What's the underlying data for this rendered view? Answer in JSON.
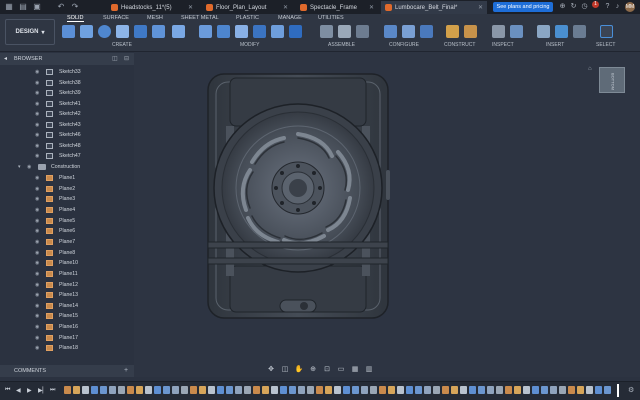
{
  "tabs": [
    {
      "label": "Headstocks_11*(5)",
      "active": false
    },
    {
      "label": "Floor_Plan_Layout",
      "active": false
    },
    {
      "label": "Spectacle_Frame",
      "active": false
    },
    {
      "label": "Lumbocare_Belt_Final*",
      "active": true
    }
  ],
  "top_right": {
    "plans_button": "See plans and pricing",
    "notification_count": "1"
  },
  "ribbon": {
    "workspace_button": "DESIGN",
    "workspace_tabs": [
      "SOLID",
      "SURFACE",
      "MESH",
      "SHEET METAL",
      "PLASTIC",
      "MANAGE",
      "UTILITIES"
    ],
    "groups": [
      "CREATE",
      "MODIFY",
      "ASSEMBLE",
      "CONFIGURE",
      "CONSTRUCT",
      "INSPECT",
      "INSERT",
      "SELECT"
    ]
  },
  "browser": {
    "title": "BROWSER",
    "sketches": [
      "Sketch33",
      "Sketch38",
      "Sketch39",
      "Sketch41",
      "Sketch42",
      "Sketch43",
      "Sketch46",
      "Sketch48",
      "Sketch47"
    ],
    "folder": "Construction",
    "planes": [
      "Plane1",
      "Plane2",
      "Plane3",
      "Plane4",
      "Plane5",
      "Plane6",
      "Plane7",
      "Plane8",
      "Plane10",
      "Plane11",
      "Plane12",
      "Plane13",
      "Plane14",
      "Plane15",
      "Plane16",
      "Plane17",
      "Plane18"
    ]
  },
  "comments": {
    "title": "COMMENTS"
  },
  "viewcube": {
    "face_label": "BOTTOM"
  },
  "colors": {
    "plans_button": "#1e6ed8",
    "viewport_bg": "#2d3442",
    "model_body": "#3f464f",
    "plane_icon": "#c98a4c"
  },
  "icons": {
    "navbar": [
      "orbit-icon",
      "look-at-icon",
      "pan-icon",
      "zoom-icon",
      "fit-icon",
      "display-settings-icon",
      "grid-icon",
      "viewports-icon"
    ],
    "playback": [
      "first-icon",
      "previous-icon",
      "play-icon",
      "next-icon",
      "last-icon"
    ]
  }
}
